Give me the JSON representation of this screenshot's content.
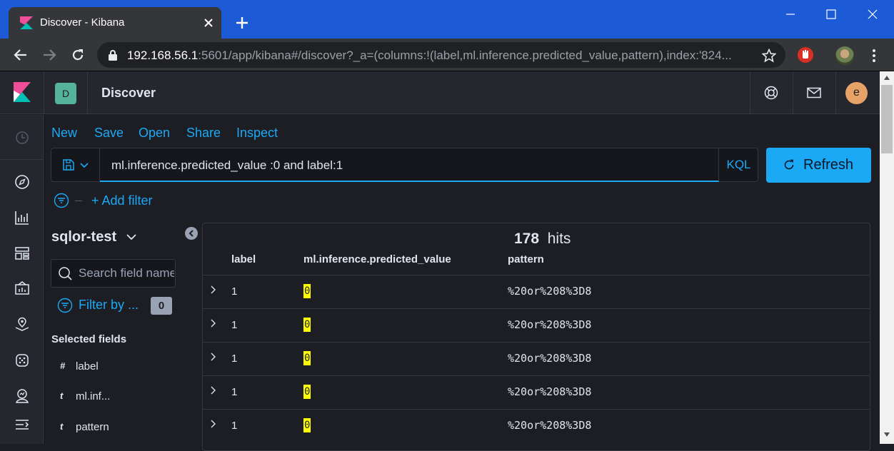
{
  "browser": {
    "tab_title": "Discover - Kibana",
    "url_host": "192.168.56.1",
    "url_rest": ":5601/app/kibana#/discover?_a=(columns:!(label,ml.inference.predicted_value,pattern),index:'824..."
  },
  "header": {
    "space_initial": "D",
    "app_title": "Discover",
    "user_initial": "e"
  },
  "topmenu": {
    "new": "New",
    "save": "Save",
    "open": "Open",
    "share": "Share",
    "inspect": "Inspect"
  },
  "query": {
    "text": "ml.inference.predicted_value :0 and label:1",
    "language": "KQL",
    "refresh_label": "Refresh"
  },
  "filters": {
    "add_filter": "+ Add filter"
  },
  "sidebar": {
    "index_pattern": "sqlor-test",
    "search_placeholder": "Search field names",
    "filter_by": "Filter by ...",
    "filter_count": "0",
    "selected_title": "Selected fields",
    "selected_fields": [
      {
        "type": "#",
        "name": "label"
      },
      {
        "type": "t",
        "name": "ml.inf..."
      },
      {
        "type": "t",
        "name": "pattern"
      }
    ]
  },
  "results": {
    "hits_count": "178",
    "hits_label": "hits",
    "columns": [
      "label",
      "ml.inference.predicted_value",
      "pattern"
    ],
    "rows": [
      {
        "label": "1",
        "predicted": "0",
        "pattern": "%20or%208%3D8"
      },
      {
        "label": "1",
        "predicted": "0",
        "pattern": "%20or%208%3D8"
      },
      {
        "label": "1",
        "predicted": "0",
        "pattern": "%20or%208%3D8"
      },
      {
        "label": "1",
        "predicted": "0",
        "pattern": "%20or%208%3D8"
      },
      {
        "label": "1",
        "predicted": "0",
        "pattern": "%20or%208%3D8"
      }
    ]
  },
  "colors": {
    "chrome_tabstrip": "#1d5bd6",
    "kibana_bg": "#1d1e24",
    "accent": "#1ba9f5",
    "highlight": "#ffff00"
  }
}
